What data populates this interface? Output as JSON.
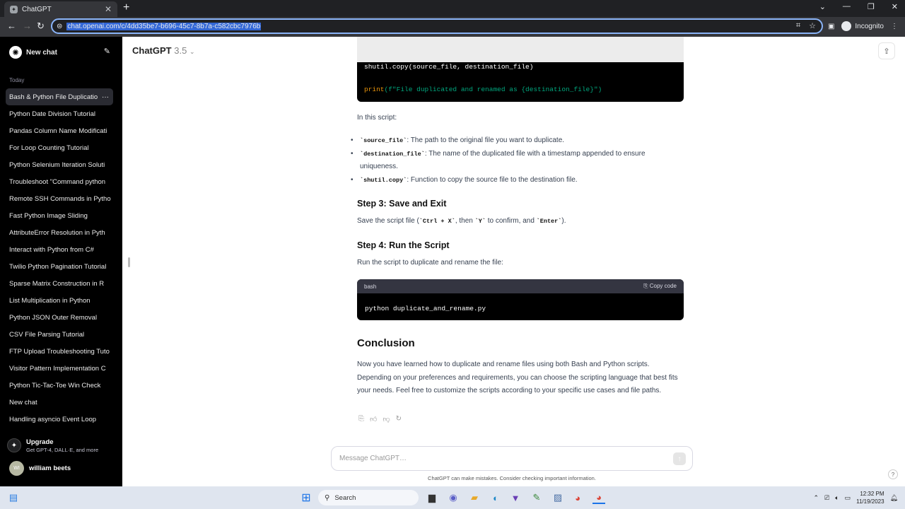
{
  "browser": {
    "tab_title": "ChatGPT",
    "url": "chat.openai.com/c/4dd35be7-b696-45c7-8b7a-c582cbc7976b",
    "profile_label": "Incognito"
  },
  "sidebar": {
    "new_chat": "New chat",
    "section_label": "Today",
    "items": [
      "Bash & Python File Duplicatio",
      "Python Date Division Tutorial",
      "Pandas Column Name Modificati",
      "For Loop Counting Tutorial",
      "Python Selenium Iteration Soluti",
      "Troubleshoot \"Command python",
      "Remote SSH Commands in Pytho",
      "Fast Python Image Sliding",
      "AttributeError Resolution in Pyth",
      "Interact with Python from C#",
      "Twilio Python Pagination Tutorial",
      "Sparse Matrix Construction in R",
      "List Multiplication in Python",
      "Python JSON Outer Removal",
      "CSV File Parsing Tutorial",
      "FTP Upload Troubleshooting Tuto",
      "Visitor Pattern Implementation C",
      "Python Tic-Tac-Toe Win Check",
      "New chat",
      "Handling asyncio Event Loop"
    ],
    "upgrade_title": "Upgrade",
    "upgrade_sub": "Get GPT-4, DALL·E, and more",
    "user_initials": "WI",
    "user_name": "william beets"
  },
  "header": {
    "model": "ChatGPT",
    "version": "3.5"
  },
  "content": {
    "code_top_line1_fn": "shutil.copy(source_file, destination_file)",
    "code_top_line2_fn": "print",
    "code_top_line2_str": "(f\"File duplicated and renamed as {destination_file}\")",
    "in_this_script": "In this script:",
    "bullet1_code": "`source_file`",
    "bullet1_text": ": The path to the original file you want to duplicate.",
    "bullet2_code": "`destination_file`",
    "bullet2_text": ": The name of the duplicated file with a timestamp appended to ensure uniqueness.",
    "bullet3_code": "`shutil.copy`",
    "bullet3_text": ": Function to copy the source file to the destination file.",
    "step3_title": "Step 3: Save and Exit",
    "step3_pre": "Save the script file (",
    "step3_k1": "`Ctrl + X`",
    "step3_mid1": ", then ",
    "step3_k2": "`Y`",
    "step3_mid2": " to confirm, and ",
    "step3_k3": "`Enter`",
    "step3_post": ").",
    "step4_title": "Step 4: Run the Script",
    "step4_text": "Run the script to duplicate and rename the file:",
    "code_lang": "bash",
    "copy_code": "Copy code",
    "code_cmd": "python duplicate_and_rename.py",
    "conclusion_title": "Conclusion",
    "conclusion_text": "Now you have learned how to duplicate and rename files using both Bash and Python scripts. Depending on your preferences and requirements, you can choose the scripting language that best fits your needs. Feel free to customize the scripts according to your specific use cases and file paths."
  },
  "composer": {
    "placeholder": "Message ChatGPT…",
    "disclaimer": "ChatGPT can make mistakes. Consider checking important information."
  },
  "taskbar": {
    "search": "Search",
    "time": "12:32 PM",
    "date": "11/19/2023"
  }
}
